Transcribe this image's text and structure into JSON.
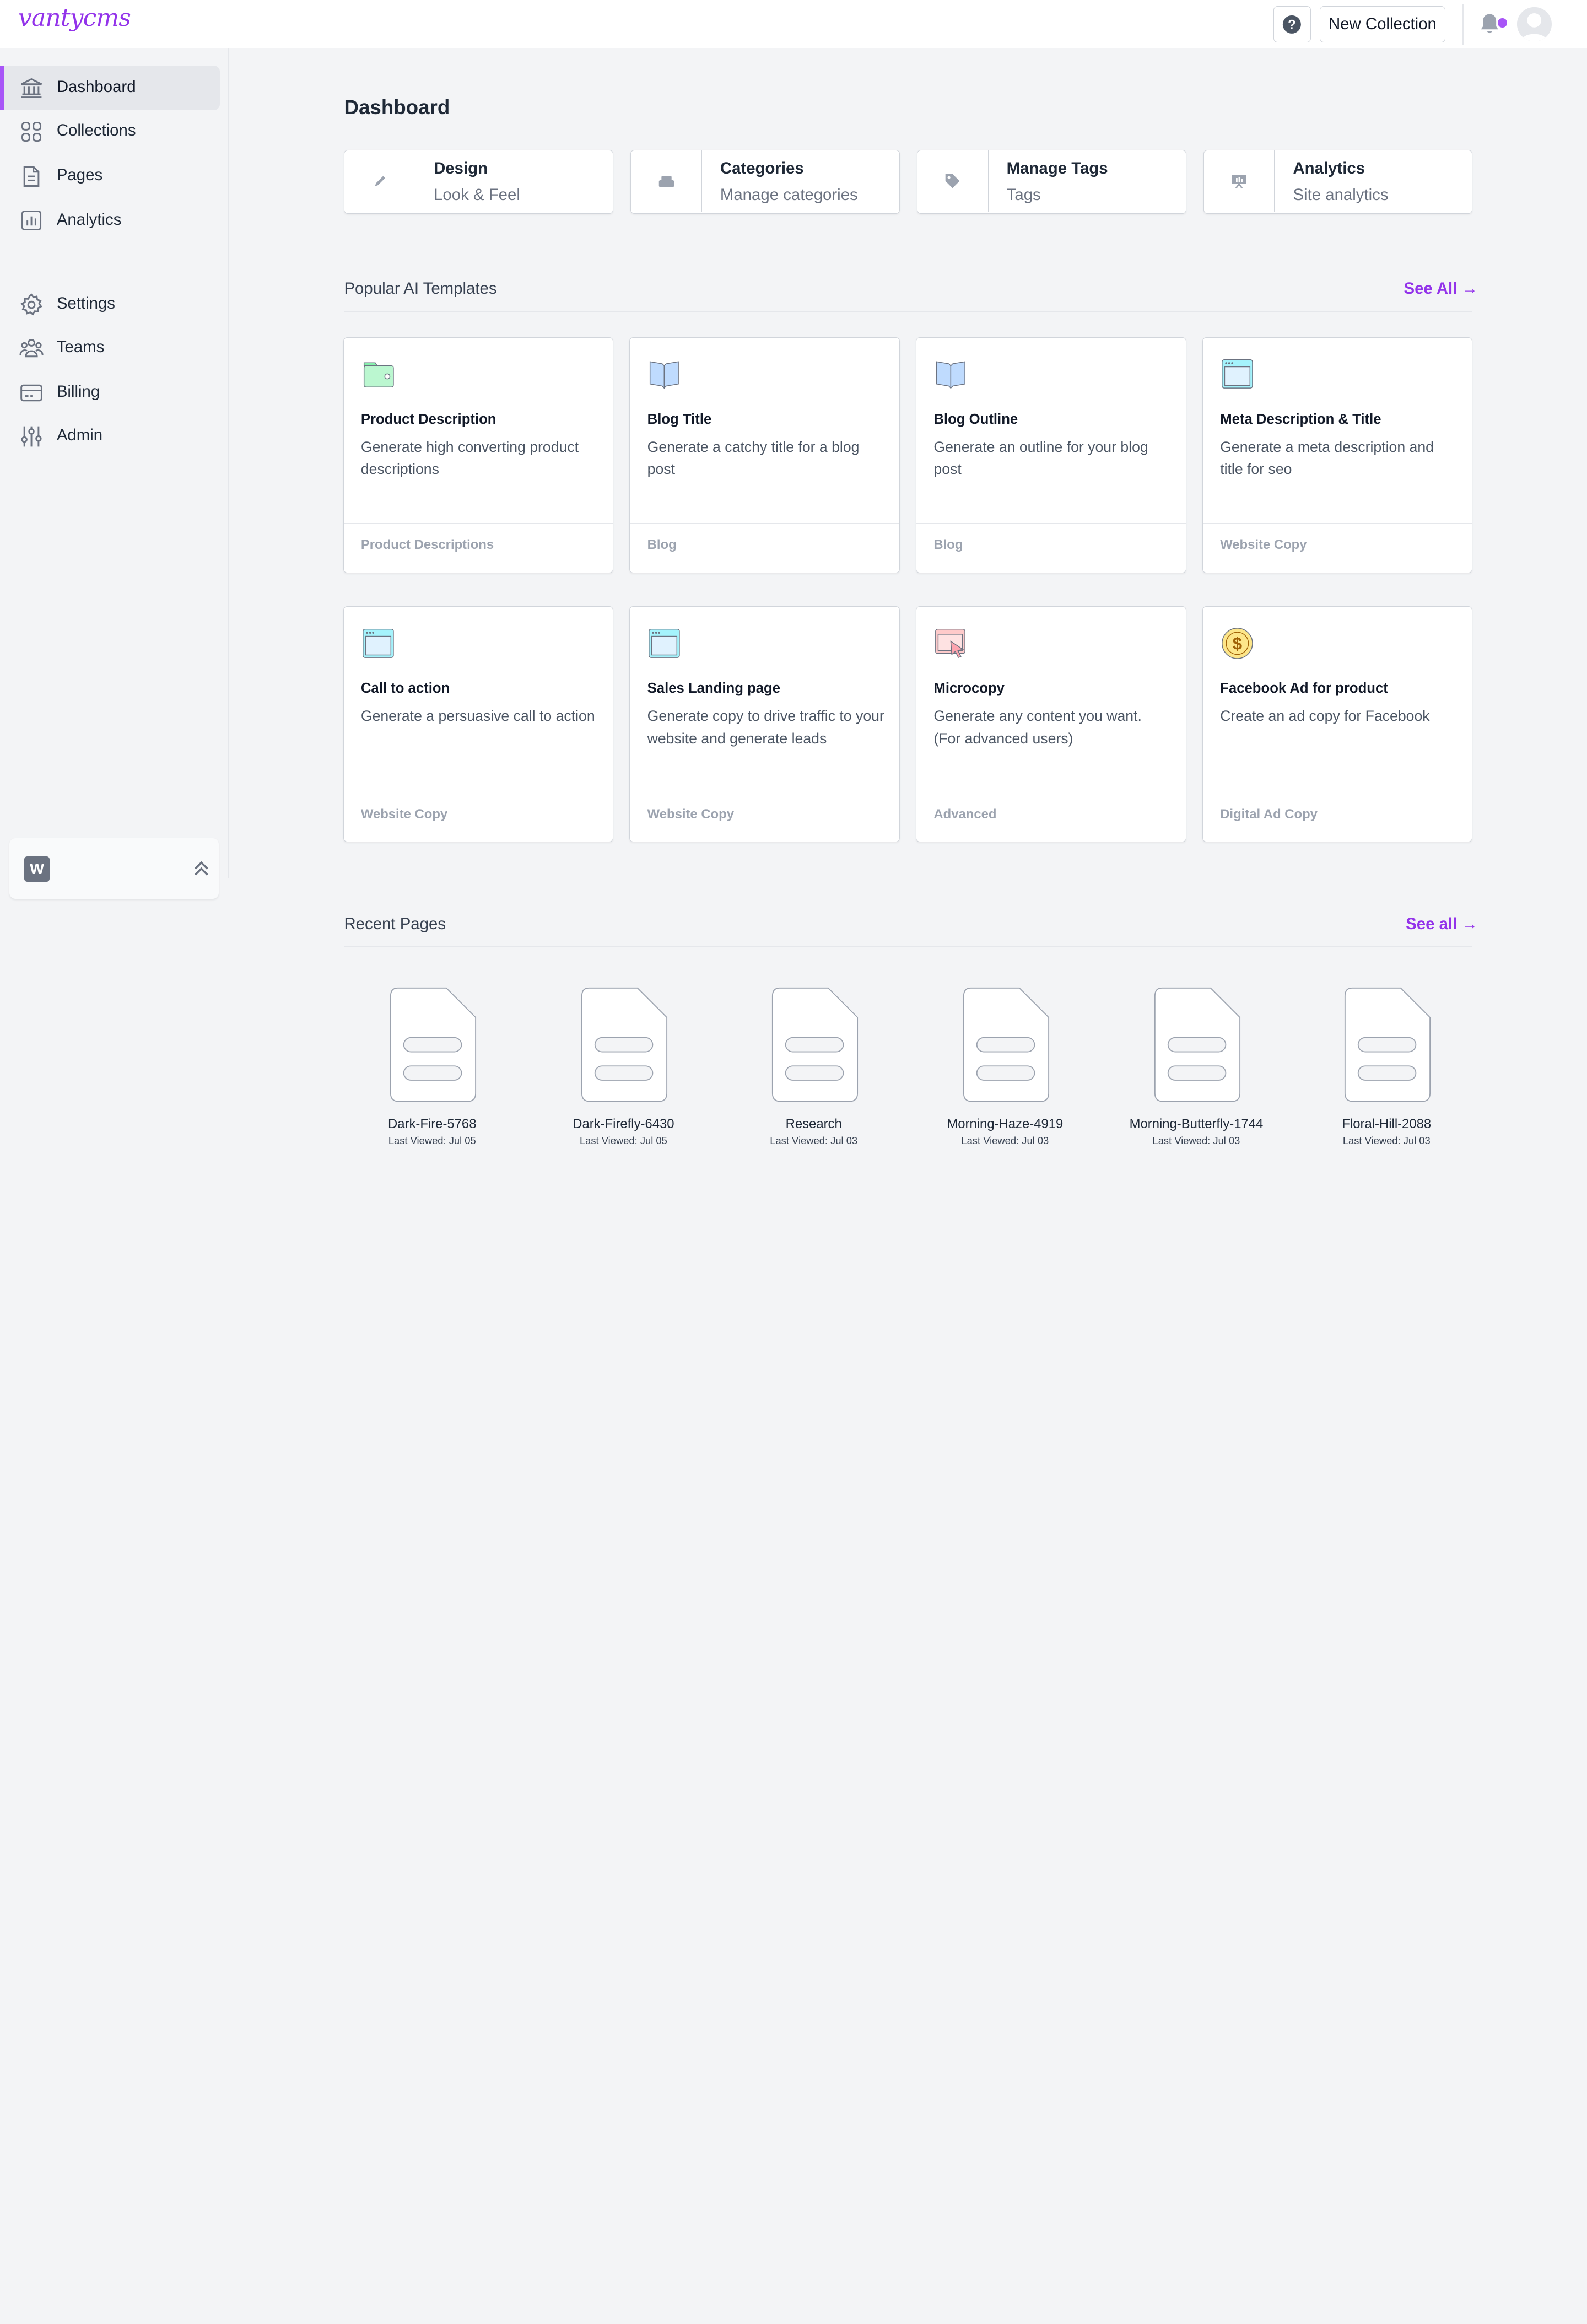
{
  "brand": {
    "logo_text": "vantycms",
    "accent": "#a855f7"
  },
  "header": {
    "help_icon": "question-circle-icon",
    "new_collection_label": "New Collection",
    "bell_icon": "bell-icon"
  },
  "sidebar": {
    "items": [
      {
        "label": "Dashboard",
        "icon": "bank-icon"
      },
      {
        "label": "Collections",
        "icon": "grid-icon"
      },
      {
        "label": "Pages",
        "icon": "document-icon"
      },
      {
        "label": "Analytics",
        "icon": "bar-chart-icon"
      },
      {
        "label": "Settings",
        "icon": "gear-icon"
      },
      {
        "label": "Teams",
        "icon": "users-icon"
      },
      {
        "label": "Billing",
        "icon": "credit-card-icon"
      },
      {
        "label": "Admin",
        "icon": "sliders-icon"
      }
    ],
    "workspace_badge": "W"
  },
  "main": {
    "title": "Dashboard",
    "quick_links": [
      {
        "title": "Design",
        "subtitle": "Look & Feel",
        "icon": "pencil-icon"
      },
      {
        "title": "Categories",
        "subtitle": "Manage categories",
        "icon": "inbox-icon"
      },
      {
        "title": "Manage Tags",
        "subtitle": "Tags",
        "icon": "tag-icon"
      },
      {
        "title": "Analytics",
        "subtitle": "Site analytics",
        "icon": "presentation-icon"
      }
    ],
    "templates_section": {
      "title": "Popular AI Templates",
      "see_all": "See All →",
      "cards": [
        {
          "title": "Product Description",
          "desc": "Generate high converting product descriptions",
          "category": "Product Descriptions",
          "icon": "wallet-icon"
        },
        {
          "title": "Blog Title",
          "desc": "Generate a catchy title for a blog post",
          "category": "Blog",
          "icon": "open-book-icon"
        },
        {
          "title": "Blog Outline",
          "desc": "Generate an outline for your blog post",
          "category": "Blog",
          "icon": "open-book-icon"
        },
        {
          "title": "Meta Description & Title",
          "desc": "Generate a meta description and title for seo",
          "category": "Website Copy",
          "icon": "browser-window-icon"
        },
        {
          "title": "Call to action",
          "desc": "Generate a persuasive call to action",
          "category": "Website Copy",
          "icon": "browser-window-icon"
        },
        {
          "title": "Sales Landing page",
          "desc": "Generate copy to drive traffic to your website and generate leads",
          "category": "Website Copy",
          "icon": "browser-window-icon"
        },
        {
          "title": "Microcopy",
          "desc": "Generate any content you want. (For advanced users)",
          "category": "Advanced",
          "icon": "cursor-window-icon"
        },
        {
          "title": "Facebook Ad for product",
          "desc": "Create an ad copy for Facebook",
          "category": "Digital Ad Copy",
          "icon": "dollar-coin-icon"
        }
      ]
    },
    "recent_section": {
      "title": "Recent Pages",
      "see_all": "See all →",
      "pages": [
        {
          "name": "Dark-Fire-5768",
          "viewed": "Last Viewed: Jul 05"
        },
        {
          "name": "Dark-Firefly-6430",
          "viewed": "Last Viewed: Jul 05"
        },
        {
          "name": "Research",
          "viewed": "Last Viewed: Jul 03"
        },
        {
          "name": "Morning-Haze-4919",
          "viewed": "Last Viewed: Jul 03"
        },
        {
          "name": "Morning-Butterfly-1744",
          "viewed": "Last Viewed: Jul 03"
        },
        {
          "name": "Floral-Hill-2088",
          "viewed": "Last Viewed: Jul 03"
        }
      ]
    }
  }
}
